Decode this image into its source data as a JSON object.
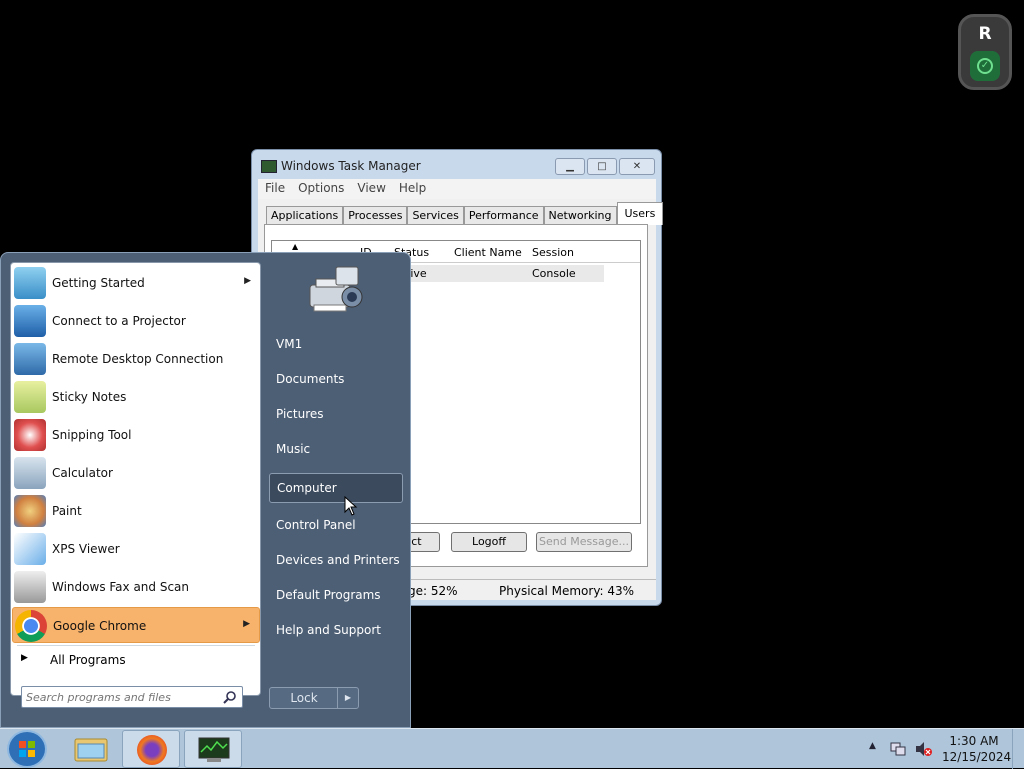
{
  "task_manager": {
    "title": "Windows Task Manager",
    "menu": [
      "File",
      "Options",
      "View",
      "Help"
    ],
    "tabs": [
      "Applications",
      "Processes",
      "Services",
      "Performance",
      "Networking",
      "Users"
    ],
    "active_tab": "Users",
    "columns": [
      "ID",
      "Status",
      "Client Name",
      "Session"
    ],
    "rows": [
      {
        "status": "ctive",
        "client_name": "",
        "session": "Console"
      }
    ],
    "buttons": {
      "disconnect": "ect",
      "logoff": "Logoff",
      "send_message": "Send Message..."
    },
    "status": {
      "cpu": "ge: 52%",
      "memory": "Physical Memory: 43%"
    }
  },
  "start_menu": {
    "programs": [
      {
        "label": "Getting Started",
        "icon": "getting-started-icon",
        "has_submenu": true
      },
      {
        "label": "Connect to a Projector",
        "icon": "projector-icon",
        "has_submenu": false
      },
      {
        "label": "Remote Desktop Connection",
        "icon": "remote-desktop-icon",
        "has_submenu": false
      },
      {
        "label": "Sticky Notes",
        "icon": "sticky-notes-icon",
        "has_submenu": false
      },
      {
        "label": "Snipping Tool",
        "icon": "snipping-tool-icon",
        "has_submenu": false
      },
      {
        "label": "Calculator",
        "icon": "calculator-icon",
        "has_submenu": false
      },
      {
        "label": "Paint",
        "icon": "paint-icon",
        "has_submenu": false
      },
      {
        "label": "XPS Viewer",
        "icon": "xps-viewer-icon",
        "has_submenu": false
      },
      {
        "label": "Windows Fax and Scan",
        "icon": "fax-scan-icon",
        "has_submenu": false
      },
      {
        "label": "Google Chrome",
        "icon": "chrome-icon",
        "has_submenu": true,
        "highlighted": true
      }
    ],
    "all_programs": "All Programs",
    "search_placeholder": "Search programs and files",
    "right_items": [
      "VM1",
      "Documents",
      "Pictures",
      "Music",
      "Computer",
      "Control Panel",
      "Devices and Printers",
      "Default Programs",
      "Help and Support"
    ],
    "highlighted_right": "Computer",
    "lock_label": "Lock"
  },
  "taskbar": {
    "time": "1:30 AM",
    "date": "12/15/2024",
    "pinned": [
      "explorer-icon",
      "firefox-icon",
      "task-manager-icon"
    ]
  },
  "colors": {
    "start_highlight": "#f7b26b",
    "taskbar": "#aec5da",
    "start_right": "#4d5f75"
  }
}
